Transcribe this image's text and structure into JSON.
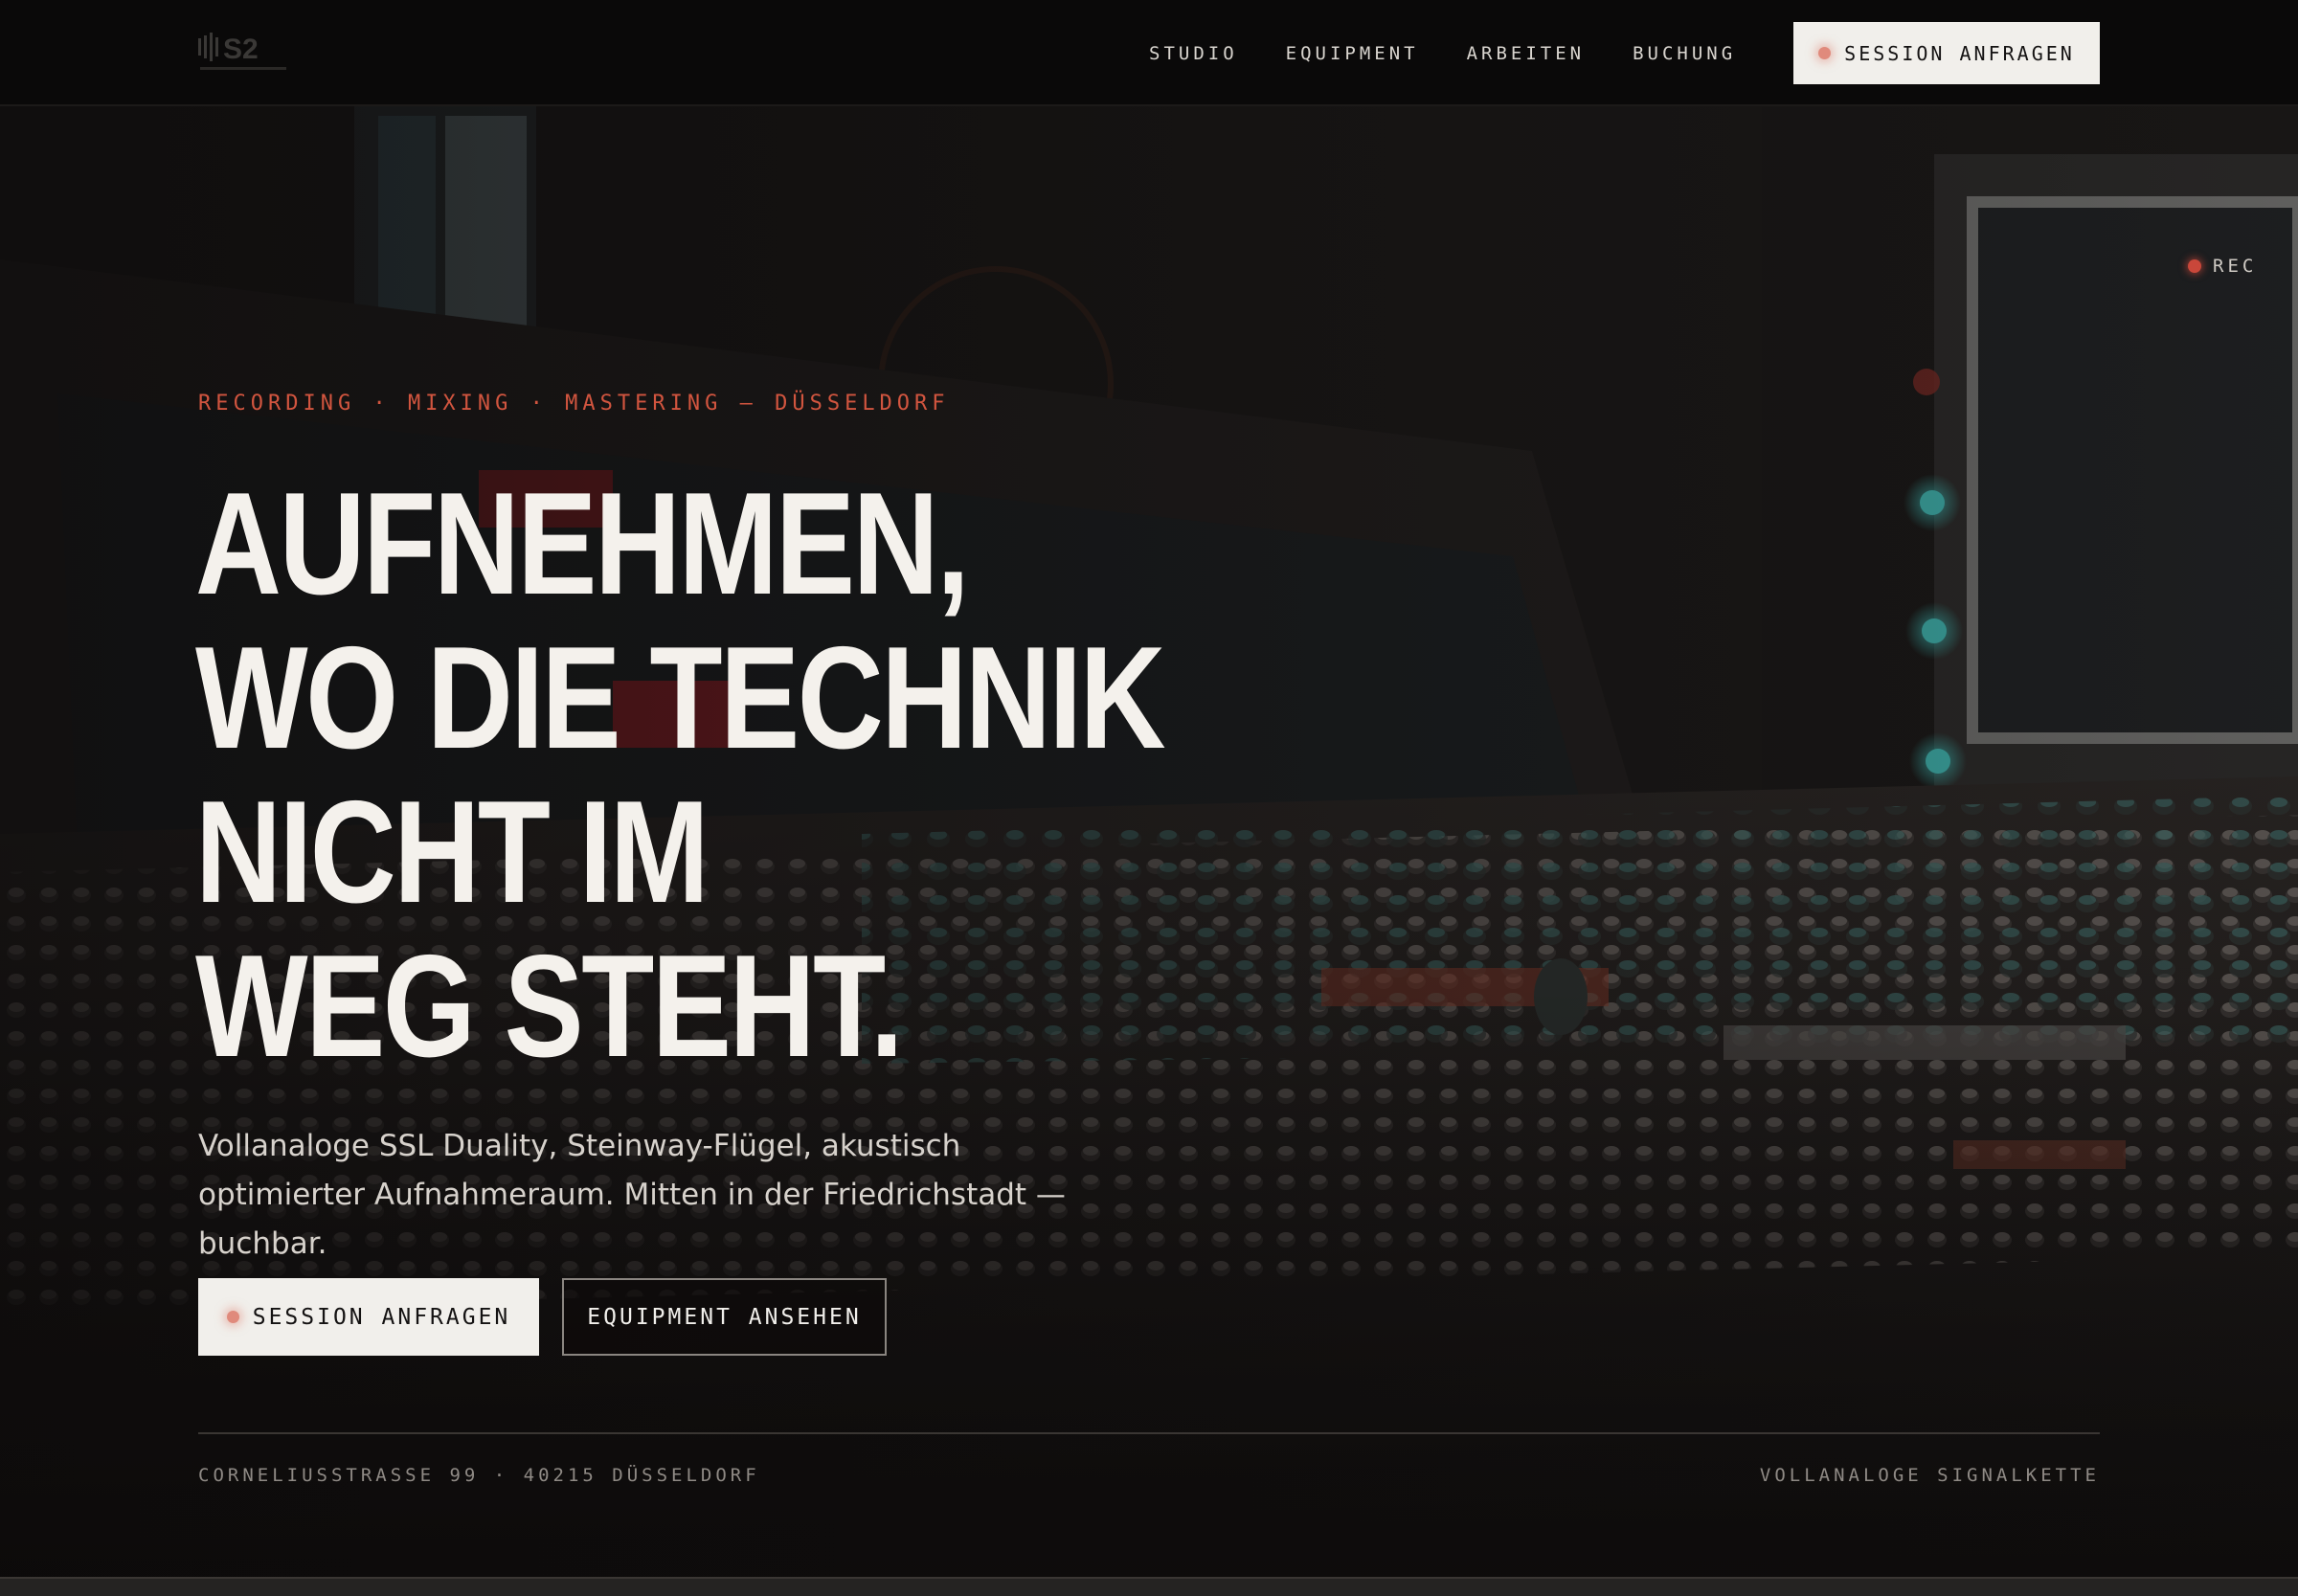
{
  "nav": {
    "logo_text": "S2",
    "links": [
      "STUDIO",
      "EQUIPMENT",
      "ARBEITEN",
      "BUCHUNG"
    ],
    "cta_label": "SESSION ANFRAGEN"
  },
  "hero": {
    "rec_label": "REC",
    "kicker": "RECORDING · MIXING · MASTERING — DÜSSELDORF",
    "headline": [
      "AUFNEHMEN,",
      "WO DIE TECHNIK",
      "NICHT IM",
      "WEG STEHT."
    ],
    "lede": "Vollanaloge SSL Duality, Steinway-Flügel, akustisch optimierter Aufnahmeraum. Mitten in der Friedrichstadt — buchbar.",
    "primary_button": "SESSION ANFRAGEN",
    "secondary_button": "EQUIPMENT ANSEHEN",
    "address": "CORNELIUSSTRASSE 99 · 40215 DÜSSELDORF",
    "signal_chain": "VOLLANALOGE SIGNALKETTE"
  },
  "colors": {
    "accent": "#d2553f",
    "background": "#0b0a0a",
    "button_light": "#f1efeb"
  },
  "icons": [
    "logo-waveform-icon",
    "status-dot-icon",
    "rec-dot-icon"
  ]
}
